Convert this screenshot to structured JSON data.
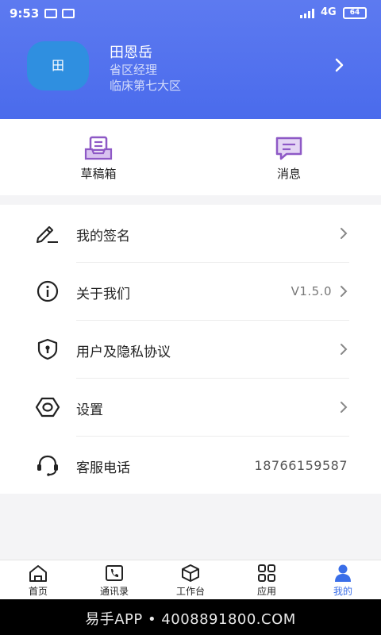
{
  "status_bar": {
    "time": "9:53",
    "network": "4G",
    "battery": "64"
  },
  "profile": {
    "avatar_text": "田",
    "name": "田恩岳",
    "role": "省区经理",
    "region": "临床第七大区"
  },
  "quick_actions": [
    {
      "label": "草稿箱",
      "icon": "draft-box-icon"
    },
    {
      "label": "消息",
      "icon": "message-icon"
    }
  ],
  "menu": [
    {
      "label": "我的签名",
      "icon": "signature-icon",
      "value": ""
    },
    {
      "label": "关于我们",
      "icon": "info-icon",
      "value": "V1.5.0"
    },
    {
      "label": "用户及隐私协议",
      "icon": "shield-icon",
      "value": ""
    },
    {
      "label": "设置",
      "icon": "settings-icon",
      "value": ""
    },
    {
      "label": "客服电话",
      "icon": "headset-icon",
      "value": "18766159587"
    }
  ],
  "tabs": [
    {
      "label": "首页",
      "icon": "home-icon"
    },
    {
      "label": "通讯录",
      "icon": "contacts-icon"
    },
    {
      "label": "工作台",
      "icon": "workbench-icon"
    },
    {
      "label": "应用",
      "icon": "apps-icon"
    },
    {
      "label": "我的",
      "icon": "profile-icon",
      "active": true
    }
  ],
  "colors": {
    "header": "#4a6bec",
    "accent": "#3a6ee8",
    "quick_icon": "#8e59c6"
  },
  "watermark": "易手APP • 4008891800.COM"
}
